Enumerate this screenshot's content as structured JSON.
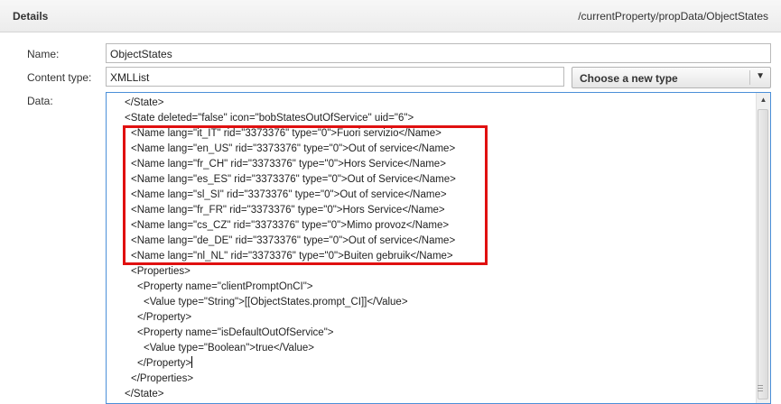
{
  "header": {
    "title": "Details",
    "path": "/currentProperty/propData/ObjectStates"
  },
  "form": {
    "name_label": "Name:",
    "name_value": "ObjectStates",
    "content_type_label": "Content type:",
    "content_type_value": "XMLList",
    "type_select_label": "Choose a new type",
    "data_label": "Data:"
  },
  "data_lines": [
    {
      "text": "</State>",
      "indent": 0
    },
    {
      "text": "<State deleted=\"false\" icon=\"bobStatesOutOfService\" uid=\"6\">",
      "indent": 0
    },
    {
      "text": "<Name lang=\"it_IT\" rid=\"3373376\" type=\"0\">Fuori servizio</Name>",
      "indent": 1
    },
    {
      "text": "<Name lang=\"en_US\" rid=\"3373376\" type=\"0\">Out of service</Name>",
      "indent": 1
    },
    {
      "text": "<Name lang=\"fr_CH\" rid=\"3373376\" type=\"0\">Hors Service</Name>",
      "indent": 1
    },
    {
      "text": "<Name lang=\"es_ES\" rid=\"3373376\" type=\"0\">Out of Service</Name>",
      "indent": 1
    },
    {
      "text": "<Name lang=\"sl_SI\" rid=\"3373376\" type=\"0\">Out of service</Name>",
      "indent": 1
    },
    {
      "text": "<Name lang=\"fr_FR\" rid=\"3373376\" type=\"0\">Hors Service</Name>",
      "indent": 1
    },
    {
      "text": "<Name lang=\"cs_CZ\" rid=\"3373376\" type=\"0\">Mimo provoz</Name>",
      "indent": 1
    },
    {
      "text": "<Name lang=\"de_DE\" rid=\"3373376\" type=\"0\">Out of service</Name>",
      "indent": 1
    },
    {
      "text": "<Name lang=\"nl_NL\" rid=\"3373376\" type=\"0\">Buiten gebruik</Name>",
      "indent": 1
    },
    {
      "text": "<Properties>",
      "indent": 1
    },
    {
      "text": "<Property name=\"clientPromptOnCI\">",
      "indent": 2
    },
    {
      "text": "<Value type=\"String\">[[ObjectStates.prompt_CI]]</Value>",
      "indent": 3
    },
    {
      "text": "</Property>",
      "indent": 2
    },
    {
      "text": "<Property name=\"isDefaultOutOfService\">",
      "indent": 2
    },
    {
      "text": "<Value type=\"Boolean\">true</Value>",
      "indent": 3
    },
    {
      "text": "</Property>",
      "indent": 2,
      "caret": true
    },
    {
      "text": "</Properties>",
      "indent": 1
    },
    {
      "text": "</State>",
      "indent": 0
    }
  ],
  "colors": {
    "highlight": "#e01010",
    "focus_border": "#4b8fd8"
  }
}
